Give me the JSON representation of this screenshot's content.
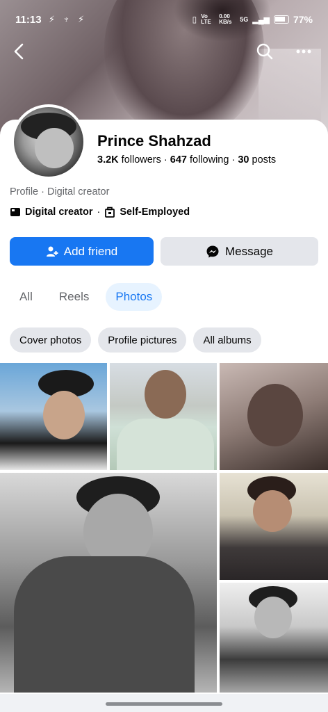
{
  "status_bar": {
    "time": "11:13",
    "left_icons": "⚡ ♆ ⚡",
    "network": "Vo LTE",
    "speed": "0.00 KB/s",
    "signal": "5G",
    "battery": "77%"
  },
  "nav": {
    "back_icon": "chevron-left-icon",
    "search_icon": "search-icon",
    "more_icon": "more-icon"
  },
  "profile": {
    "name": "Prince Shahzad",
    "followers_count": "3.2K",
    "followers_label": "followers",
    "following_count": "647",
    "following_label": "following",
    "posts_count": "30",
    "posts_label": "posts",
    "category_line": "Profile · Digital creator",
    "tag_creator": "Digital creator",
    "tag_separator": "·",
    "tag_employment": "Self-Employed"
  },
  "actions": {
    "add_friend": "Add friend",
    "message": "Message"
  },
  "tabs": [
    {
      "label": "All",
      "active": false
    },
    {
      "label": "Reels",
      "active": false
    },
    {
      "label": "Photos",
      "active": true
    }
  ],
  "chips": [
    {
      "label": "Cover photos"
    },
    {
      "label": "Profile pictures"
    },
    {
      "label": "All albums"
    }
  ],
  "colors": {
    "accent": "#1877f2",
    "secondary_button": "#e4e6eb",
    "active_tab_bg": "#e7f3ff"
  }
}
